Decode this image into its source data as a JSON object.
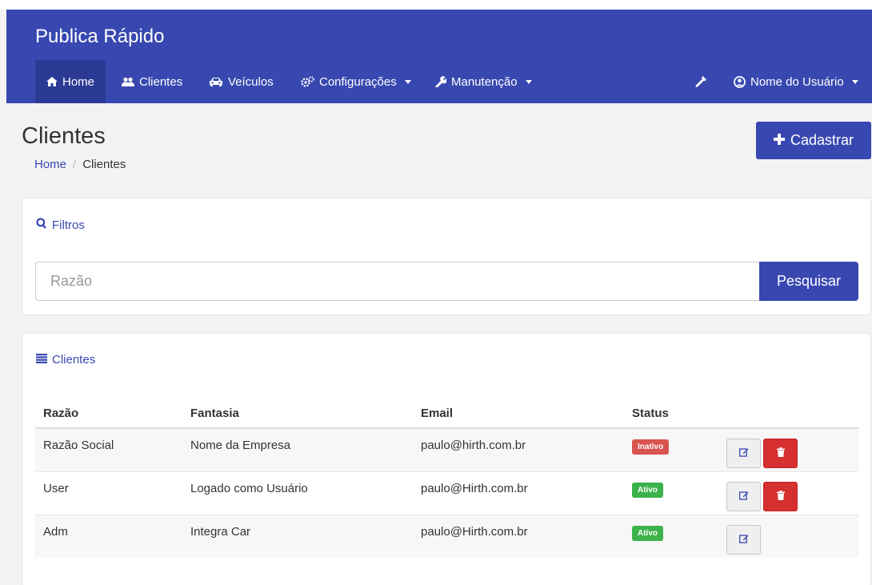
{
  "app": {
    "brand": "Publica Rápido"
  },
  "nav": {
    "items": [
      {
        "label": "Home",
        "icon": "home-icon",
        "active": true
      },
      {
        "label": "Clientes",
        "icon": "users-icon"
      },
      {
        "label": "Veículos",
        "icon": "car-icon"
      },
      {
        "label": "Configurações",
        "icon": "cogs-icon",
        "dropdown": true
      },
      {
        "label": "Manutenção",
        "icon": "wrench-icon",
        "dropdown": true
      }
    ],
    "tool_icon": "eyedropper-icon",
    "user": {
      "label": "Nome do Usuário",
      "icon": "user-circle-icon",
      "dropdown": true
    }
  },
  "page": {
    "title": "Clientes",
    "breadcrumb": {
      "home": "Home",
      "separator": "/",
      "current": "Clientes"
    },
    "add_button": "Cadastrar"
  },
  "filters": {
    "heading": "Filtros",
    "search": {
      "placeholder": "Razão",
      "value": ""
    },
    "search_button": "Pesquisar"
  },
  "list": {
    "heading": "Clientes",
    "columns": [
      "Razão",
      "Fantasia",
      "Email",
      "Status"
    ],
    "rows": [
      {
        "razao": "Razão Social",
        "fantasia": "Nome da Empresa",
        "email": "paulo@hirth.com.br",
        "status": "Inativo",
        "can_delete": true
      },
      {
        "razao": "User",
        "fantasia": "Logado como Usuário",
        "email": "paulo@Hirth.com.br",
        "status": "Ativo",
        "can_delete": true
      },
      {
        "razao": "Adm",
        "fantasia": "Integra Car",
        "email": "paulo@Hirth.com.br",
        "status": "Ativo",
        "can_delete": false
      }
    ]
  },
  "colors": {
    "primary": "#3848b0",
    "nav_active": "#2b3a94",
    "danger": "#d9534f",
    "success": "#3cb24a"
  }
}
